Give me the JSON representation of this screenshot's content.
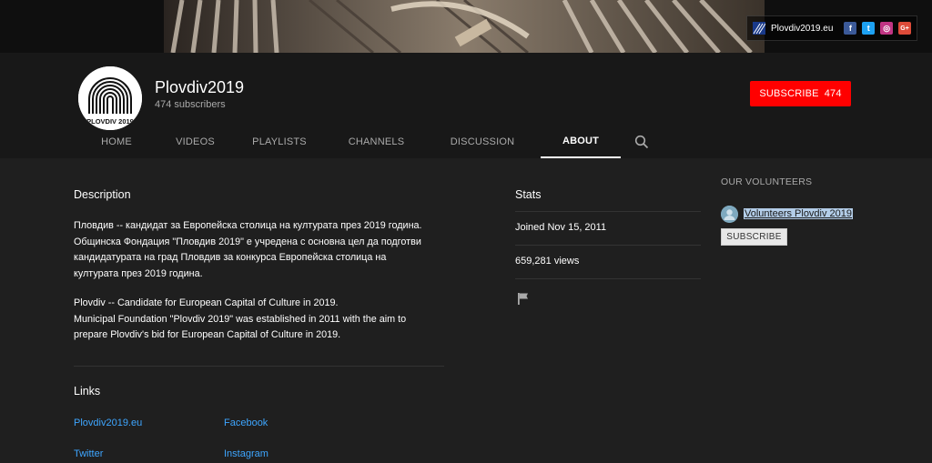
{
  "banner": {
    "site_label": "Plovdiv2019.eu",
    "social_icons": [
      "facebook-icon",
      "twitter-icon",
      "instagram-icon",
      "google-plus-icon"
    ],
    "social_glyphs": {
      "facebook": "f",
      "twitter": "t",
      "instagram": "◎",
      "google_plus": "G+"
    }
  },
  "channel": {
    "title": "Plovdiv2019",
    "subscribers": "474 subscribers",
    "avatar_text": "PLOVDIV 2019"
  },
  "subscribe": {
    "label": "SUBSCRIBE",
    "count": "474"
  },
  "tabs": [
    {
      "label": "HOME"
    },
    {
      "label": "VIDEOS"
    },
    {
      "label": "PLAYLISTS"
    },
    {
      "label": "CHANNELS"
    },
    {
      "label": "DISCUSSION"
    },
    {
      "label": "ABOUT",
      "active": true
    }
  ],
  "description": {
    "heading": "Description",
    "bg_lines": [
      "Пловдив -- кандидат за Европейска столица на културата през 2019 година.",
      "Общинска Фондация \"Пловдив 2019\" е учредена с основна цел да подготви",
      "кандидатурата на град Пловдив за конкурса Европейска столица на",
      "културата през 2019 година."
    ],
    "en_lines": [
      "Plovdiv -- Candidate for European Capital of Culture in 2019.",
      "Municipal Foundation \"Plovdiv 2019\" was established in 2011 with the aim to",
      "prepare Plovdiv's bid for European Capital of Culture in 2019."
    ]
  },
  "links": {
    "heading": "Links",
    "items": [
      "Plovdiv2019.eu",
      "Facebook",
      "Twitter",
      "Instagram"
    ]
  },
  "stats": {
    "heading": "Stats",
    "joined": "Joined Nov 15, 2011",
    "views": "659,281 views"
  },
  "volunteers": {
    "heading": "OUR VOLUNTEERS",
    "name": "Volunteers Plovdiv 2019",
    "subscribe_label": "SUBSCRIBE"
  },
  "colors": {
    "background": "#1f1f1f",
    "header": "#181818",
    "subscribe_red": "#ff0000",
    "link_blue": "#3ea6ff",
    "facebook": "#3b5998",
    "twitter": "#1da1f2",
    "instagram": "#c13584",
    "google_plus": "#dd4b39"
  }
}
